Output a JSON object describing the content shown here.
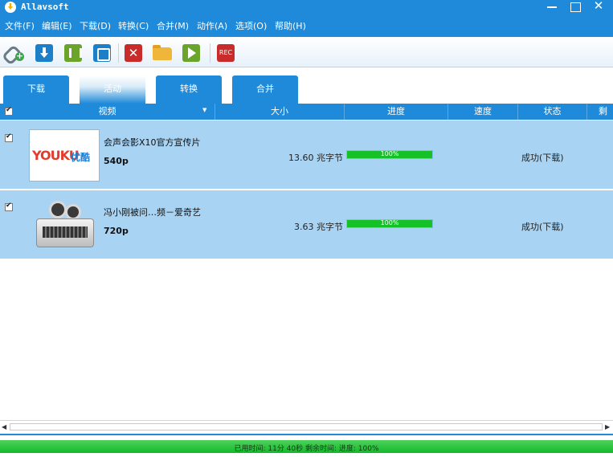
{
  "window": {
    "title": "Allavsoft"
  },
  "menu": [
    "文件(F)",
    "编辑(E)",
    "下载(D)",
    "转换(C)",
    "合并(M)",
    "动作(A)",
    "选项(O)",
    "帮助(H)"
  ],
  "toolbar": {
    "rec_label": "REC"
  },
  "tabs": [
    "下载",
    "活动",
    "转换",
    "合并"
  ],
  "active_tab": "活动",
  "columns": [
    "视频",
    "大小",
    "进度",
    "速度",
    "状态",
    "剩"
  ],
  "rows": [
    {
      "checked": true,
      "thumbnail": "youku-logo",
      "thumb_text_a": "YOUKU",
      "thumb_text_b": "优酷",
      "title": "会声会影X10官方宣传片",
      "quality": "540p",
      "size": "13.60 兆字节",
      "progress": 100,
      "progress_text": "100%",
      "speed": "",
      "status": "成功(下载)"
    },
    {
      "checked": true,
      "thumbnail": "film-projector-icon",
      "title": "冯小刚被问…频－爱奇艺",
      "quality": "720p",
      "size": "3.63 兆字节",
      "progress": 100,
      "progress_text": "100%",
      "speed": "",
      "status": "成功(下载)"
    }
  ],
  "statusbar": {
    "text": "已用时间: 11分 40秒 剩余时间:  进度: 100%",
    "progress": 100
  },
  "colors": {
    "accent": "#1f8ad9",
    "row_selected": "#a9d3f2",
    "progress_fill": "#15c127",
    "danger": "#c92b2b",
    "ok_green": "#6aa42b"
  }
}
